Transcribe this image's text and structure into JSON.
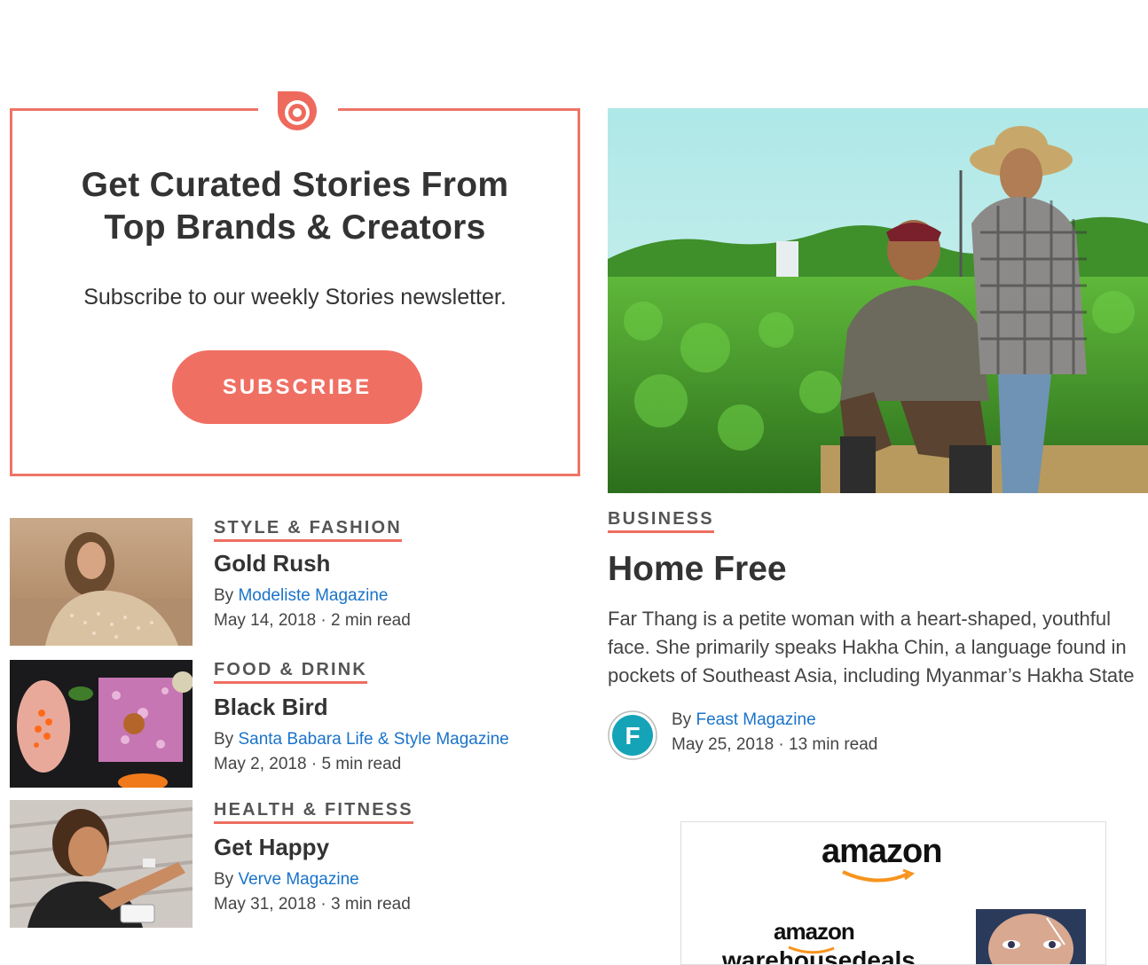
{
  "subscribe": {
    "title_line1": "Get Curated Stories From",
    "title_line2": "Top Brands & Creators",
    "text": "Subscribe to our weekly Stories newsletter.",
    "button": "SUBSCRIBE",
    "accent": "#f06f63"
  },
  "stories": [
    {
      "category": "STYLE & FASHION",
      "title": "Gold Rush",
      "by": "By",
      "author": "Modeliste Magazine",
      "meta": "May 14, 2018 · 2 min read"
    },
    {
      "category": "FOOD & DRINK",
      "title": "Black Bird",
      "by": "By",
      "author": "Santa Babara Life & Style Magazine",
      "meta": "May 2, 2018 · 5 min read"
    },
    {
      "category": "HEALTH & FITNESS",
      "title": "Get Happy",
      "by": "By",
      "author": "Verve Magazine",
      "meta": "May 31, 2018 · 3 min read"
    }
  ],
  "featured": {
    "category": "BUSINESS",
    "title": "Home Free",
    "excerpt_line1": "Far Thang is a petite woman with a heart-shaped, youthful",
    "excerpt_line2": "face. She primarily speaks Hakha Chin, a language found in",
    "excerpt_line3": "pockets of Southeast Asia, including Myanmar’s Hakha State",
    "by": "By",
    "author": "Feast Magazine",
    "meta": "May 25, 2018 · 13 min read",
    "avatar_letter": "F"
  },
  "ad": {
    "logo": "amazon",
    "logo2": "amazon",
    "sub": "warehousedeals"
  },
  "icons": {
    "brand": "issuu-logo-icon"
  }
}
